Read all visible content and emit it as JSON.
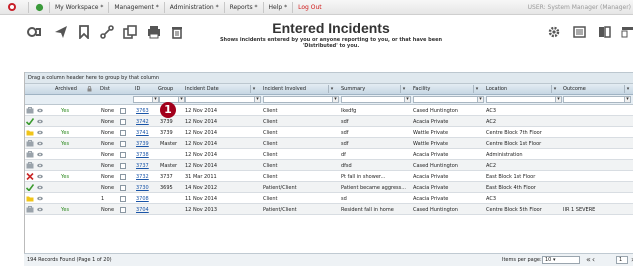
{
  "topnav": {
    "items": [
      "My Workspace *",
      "Management *",
      "Administration *",
      "Reports *",
      "Help *"
    ],
    "logout": "Log Out",
    "user": "USER: System Manager (Manager)"
  },
  "page": {
    "title": "Entered Incidents",
    "subtitle": "Shows incidents entered by you or anyone reporting to you, or that have been 'Distributed' to you."
  },
  "toolbar": {
    "left_icons": [
      "incident-icon",
      "send-icon",
      "bookmark-icon",
      "share-icon",
      "copy-icon",
      "print-icon",
      "delete-icon"
    ],
    "right_icons": [
      "settings-icon",
      "list-view-icon",
      "grid-view-icon",
      "filter-view-icon"
    ]
  },
  "grid": {
    "group_hint": "Drag a column header here to group by that column",
    "columns": [
      "Archived",
      "Dist",
      "ID",
      "Group",
      "Incident Date",
      "Incident Involved",
      "Summary",
      "Facility",
      "Location",
      "Outcome"
    ],
    "rows": [
      {
        "icon": "case",
        "archived": "Yes",
        "dist": "None",
        "id": "3763",
        "group": "3763",
        "date": "12 Nov 2014",
        "involved": "Client",
        "summary": "lkedfg",
        "facility": "Cased Huntington",
        "location": "AC3",
        "outcome": ""
      },
      {
        "icon": "check",
        "archived": "",
        "dist": "None",
        "id": "3742",
        "group": "3739",
        "date": "12 Nov 2014",
        "involved": "Client",
        "summary": "sdf",
        "facility": "Acacia Private",
        "location": "AC2",
        "outcome": ""
      },
      {
        "icon": "folder",
        "archived": "Yes",
        "dist": "None",
        "id": "3741",
        "group": "3739",
        "date": "12 Nov 2014",
        "involved": "Client",
        "summary": "sdf",
        "facility": "Wattle Private",
        "location": "Centre Block 7th Floor",
        "outcome": ""
      },
      {
        "icon": "case",
        "archived": "Yes",
        "dist": "None",
        "id": "3739",
        "group": "Master",
        "date": "12 Nov 2014",
        "involved": "Client",
        "summary": "sdf",
        "facility": "Wattle Private",
        "location": "Centre Block 1st Floor",
        "outcome": ""
      },
      {
        "icon": "case",
        "archived": "",
        "dist": "None",
        "id": "3738",
        "group": "",
        "date": "12 Nov 2014",
        "involved": "Client",
        "summary": "df",
        "facility": "Acacia Private",
        "location": "Administration",
        "outcome": ""
      },
      {
        "icon": "case",
        "archived": "",
        "dist": "None",
        "id": "3737",
        "group": "Master",
        "date": "12 Nov 2014",
        "involved": "Client",
        "summary": "dfsd",
        "facility": "Cased Huntington",
        "location": "AC2",
        "outcome": ""
      },
      {
        "icon": "cross",
        "archived": "Yes",
        "dist": "None",
        "id": "3732",
        "group": "3737",
        "date": "31 Mar 2011",
        "involved": "Client",
        "summary": "Pt fall in shower...",
        "facility": "Acacia Private",
        "location": "East Block 1st Floor",
        "outcome": ""
      },
      {
        "icon": "check",
        "archived": "",
        "dist": "None",
        "id": "3730",
        "group": "3695",
        "date": "14 Nov 2012",
        "involved": "Patient/Client",
        "summary": "Patient became aggress...",
        "facility": "Acacia Private",
        "location": "East Block 4th Floor",
        "outcome": ""
      },
      {
        "icon": "folder",
        "archived": "",
        "dist": "1",
        "id": "3708",
        "group": "",
        "date": "11 Nov 2014",
        "involved": "Client",
        "summary": "sd",
        "facility": "Acacia Private",
        "location": "AC3",
        "outcome": ""
      },
      {
        "icon": "case",
        "archived": "Yes",
        "dist": "None",
        "id": "3704",
        "group": "",
        "date": "12 Nov 2013",
        "involved": "Patient/Client",
        "summary": "Resident fall in home",
        "facility": "Cased Huntington",
        "location": "Centre Block 5th Floor",
        "outcome": "IIR 1 SEVERE"
      }
    ]
  },
  "footer": {
    "count": "194 Records Found (Page 1 of 20)",
    "items_per_page_label": "Items per page:",
    "items_per_page": "10",
    "page": "1"
  },
  "badge": "1"
}
